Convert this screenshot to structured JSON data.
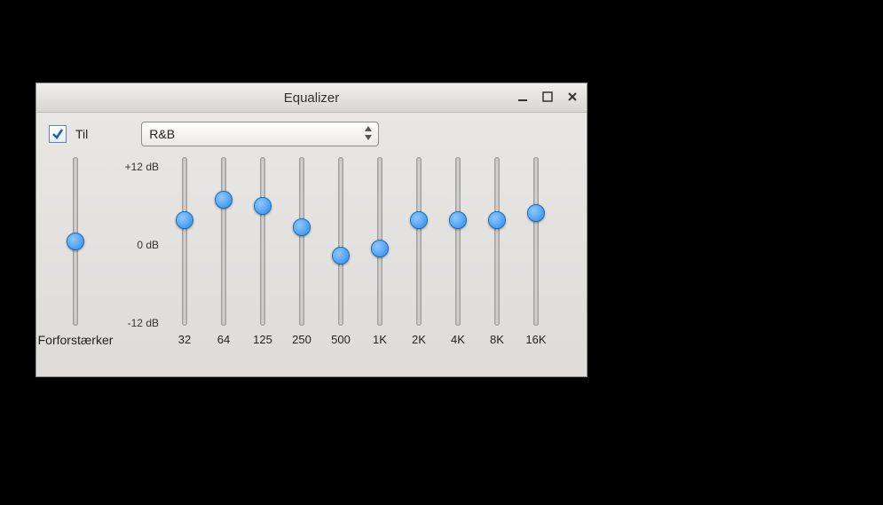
{
  "window": {
    "title": "Equalizer"
  },
  "enable": {
    "checked": true,
    "label": "Til"
  },
  "preset": {
    "selected": "R&B"
  },
  "scale": {
    "max": "+12 dB",
    "mid": "0 dB",
    "min": "-12 dB"
  },
  "preamp": {
    "label": "Forforstærker",
    "value_db": 0
  },
  "bands": [
    {
      "freq": "32",
      "value_db": 3
    },
    {
      "freq": "64",
      "value_db": 6
    },
    {
      "freq": "125",
      "value_db": 5
    },
    {
      "freq": "250",
      "value_db": 2
    },
    {
      "freq": "500",
      "value_db": -2
    },
    {
      "freq": "1K",
      "value_db": -1
    },
    {
      "freq": "2K",
      "value_db": 3
    },
    {
      "freq": "4K",
      "value_db": 3
    },
    {
      "freq": "8K",
      "value_db": 3
    },
    {
      "freq": "16K",
      "value_db": 4
    }
  ]
}
